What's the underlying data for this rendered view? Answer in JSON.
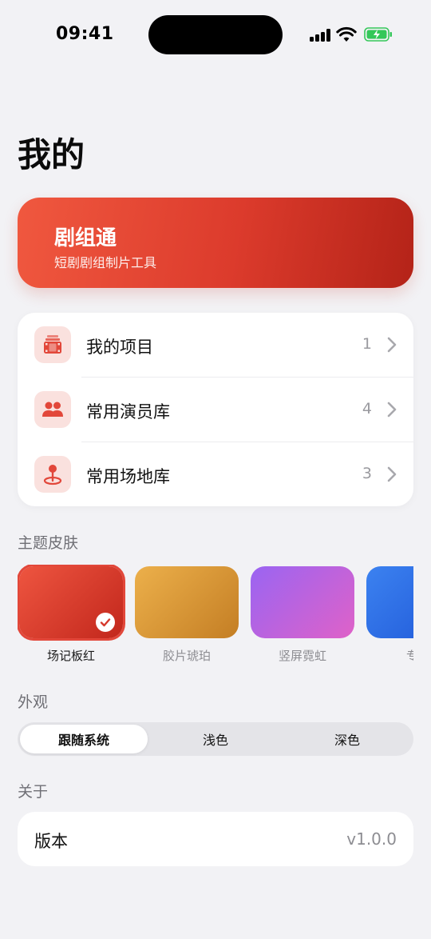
{
  "status_bar": {
    "time": "09:41"
  },
  "page_title": "我的",
  "hero": {
    "title": "剧组通",
    "subtitle": "短剧剧组制片工具"
  },
  "menu": [
    {
      "label": "我的项目",
      "count": "1",
      "icon": "film-stack-icon"
    },
    {
      "label": "常用演员库",
      "count": "4",
      "icon": "people-icon"
    },
    {
      "label": "常用场地库",
      "count": "3",
      "icon": "location-pin-icon"
    }
  ],
  "themes": {
    "section_label": "主题皮肤",
    "items": [
      {
        "name": "场记板红",
        "colors": [
          "#ee5540",
          "#c2271c"
        ],
        "selected": true
      },
      {
        "name": "胶片琥珀",
        "colors": [
          "#ecb04b",
          "#c47e24"
        ],
        "selected": false
      },
      {
        "name": "竖屏霓虹",
        "colors": [
          "#9a64f2",
          "#df62c8"
        ],
        "selected": false
      },
      {
        "name": "专业",
        "colors": [
          "#3c82f0",
          "#1d55d6"
        ],
        "selected": false
      }
    ]
  },
  "appearance": {
    "section_label": "外观",
    "options": [
      "跟随系统",
      "浅色",
      "深色"
    ],
    "selected": "跟随系统"
  },
  "about": {
    "section_label": "关于",
    "version_label": "版本",
    "version_value": "v1.0.0"
  },
  "colors": {
    "accent": "#e2473a",
    "accent_soft": "#fae1de",
    "background": "#f2f2f5"
  }
}
